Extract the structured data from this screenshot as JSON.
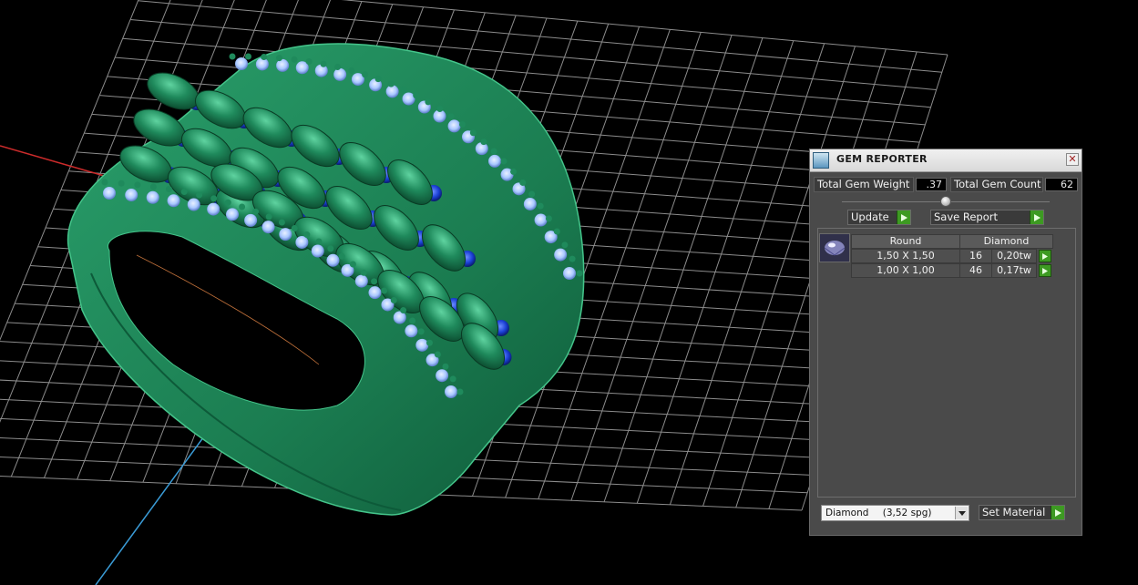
{
  "panel": {
    "title": "GEM REPORTER",
    "total_weight_label": "Total Gem Weight",
    "total_weight_value": ".37",
    "total_count_label": "Total Gem Count",
    "total_count_value": "62",
    "update_label": "Update",
    "save_report_label": "Save Report",
    "table": {
      "shape_header": "Round",
      "material_header": "Diamond",
      "rows": [
        {
          "size": "1,50 X 1,50",
          "count": "16",
          "weight": "0,20tw"
        },
        {
          "size": "1,00 X 1,00",
          "count": "46",
          "weight": "0,17tw"
        }
      ]
    },
    "material_select": {
      "name": "Diamond",
      "spg": "(3,52 spg)"
    },
    "set_material_label": "Set Material"
  },
  "colors": {
    "ring_green": "#1f8a5c",
    "sapphire_blue": "#1a3fd4",
    "diamond_blue": "#a9c8ff",
    "go_green": "#3d9a22",
    "axis_red": "#cc2b2b",
    "axis_blue": "#3a9bd6"
  },
  "icons": [
    "close-icon",
    "play-arrow-icon",
    "dropdown-arrow-icon",
    "gem-icon",
    "app-icon",
    "splitter-knob-icon"
  ]
}
